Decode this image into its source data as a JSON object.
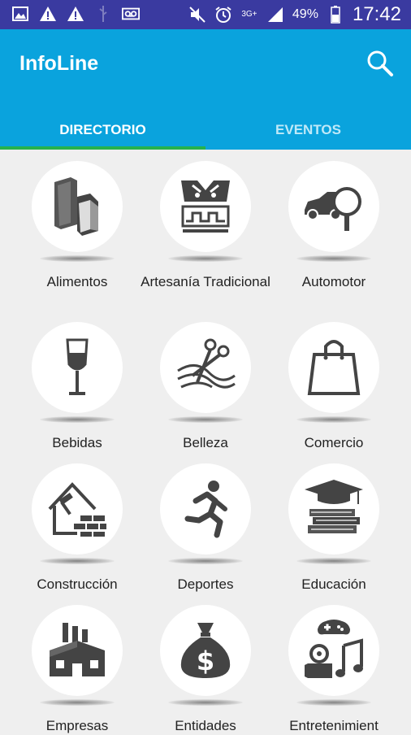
{
  "status_bar": {
    "battery_percent": "49%",
    "time": "17:42",
    "network": "3G+",
    "icons": [
      "picture-icon",
      "warning-icon",
      "warning-icon",
      "usb-icon",
      "voicemail-icon",
      "mute-icon",
      "alarm-icon",
      "network-icon",
      "signal-icon",
      "battery-icon"
    ]
  },
  "app_bar": {
    "title": "InfoLine",
    "search_icon": "search-icon",
    "color": "#0aa3dd"
  },
  "tabs": [
    {
      "label": "DIRECTORIO",
      "active": true
    },
    {
      "label": "EVENTOS",
      "active": false
    }
  ],
  "accent": "#26b24c",
  "categories": [
    {
      "label": "Alimentos",
      "icon": "food-box-icon"
    },
    {
      "label": "Artesanía Tradicional",
      "icon": "handicraft-icon"
    },
    {
      "label": "Automotor",
      "icon": "car-search-icon"
    },
    {
      "label": "Bebidas",
      "icon": "wine-glass-icon"
    },
    {
      "label": "Belleza",
      "icon": "scissors-hair-icon"
    },
    {
      "label": "Comercio",
      "icon": "shopping-bag-icon"
    },
    {
      "label": "Construcción",
      "icon": "house-brick-icon"
    },
    {
      "label": "Deportes",
      "icon": "runner-icon"
    },
    {
      "label": "Educación",
      "icon": "graduation-books-icon"
    },
    {
      "label": "Empresas",
      "icon": "factory-icon"
    },
    {
      "label": "Entidades",
      "icon": "money-bag-icon"
    },
    {
      "label": "Entretenimient",
      "icon": "entertainment-icon"
    }
  ]
}
